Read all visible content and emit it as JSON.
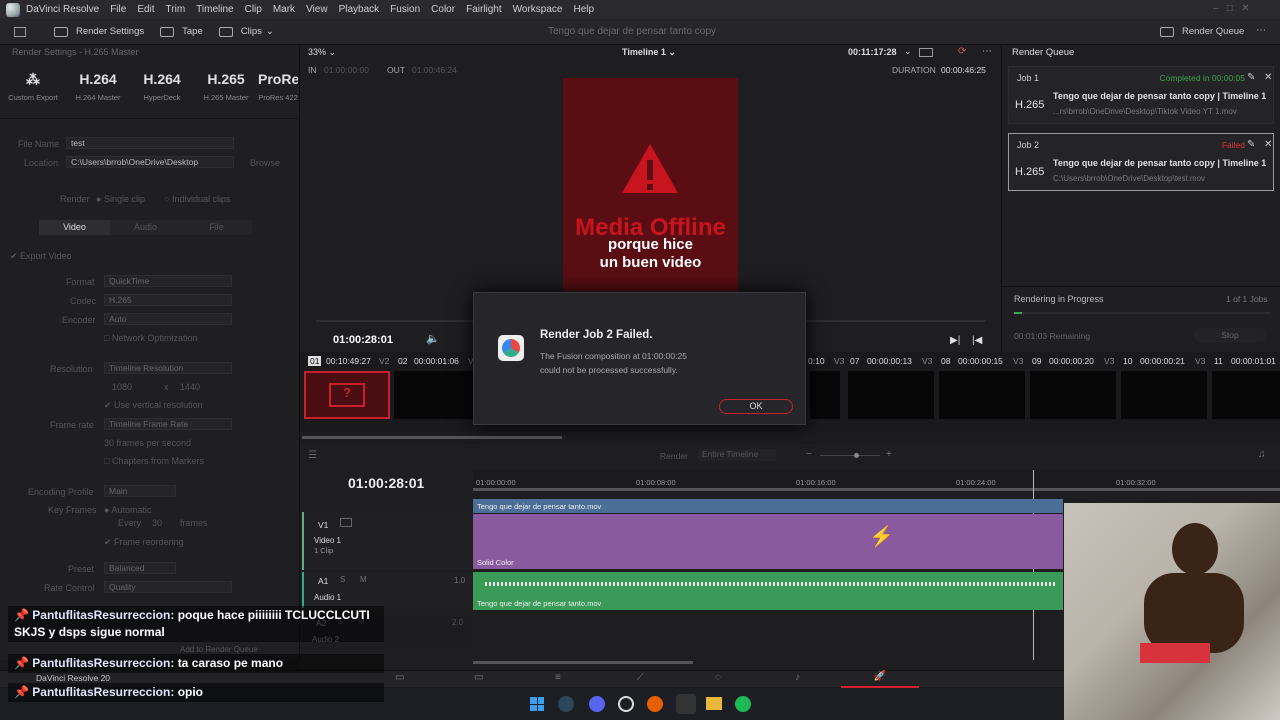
{
  "menubar": {
    "app": "DaVinci Resolve",
    "items": [
      "File",
      "Edit",
      "Trim",
      "Timeline",
      "Clip",
      "Mark",
      "View",
      "Playback",
      "Fusion",
      "Color",
      "Fairlight",
      "Workspace",
      "Help"
    ]
  },
  "topbar": {
    "render_settings": "Render Settings",
    "tape": "Tape",
    "clips": "Clips",
    "project": "Tengo que dejar de pensar tanto copy",
    "render_queue": "Render Queue"
  },
  "left": {
    "title": "Render Settings - H.265 Master",
    "presets": [
      {
        "big": "",
        "small": "Custom Export"
      },
      {
        "big": "H.264",
        "small": "H.264 Master"
      },
      {
        "big": "H.264",
        "small": "HyperDeck"
      },
      {
        "big": "H.265",
        "small": "H.265 Master"
      },
      {
        "big": "ProRe",
        "small": "ProRes 422"
      }
    ],
    "file_name_label": "File Name",
    "file_name": "test",
    "location_label": "Location",
    "location": "C:\\Users\\brrob\\OneDrive\\Desktop",
    "browse": "Browse",
    "render_label": "Render",
    "single_clip": "Single clip",
    "individual_clips": "Individual clips",
    "tabs": [
      "Video",
      "Audio",
      "File"
    ],
    "export_video": "Export Video",
    "format_label": "Format",
    "format": "QuickTime",
    "codec_label": "Codec",
    "codec": "H.265",
    "encoder_label": "Encoder",
    "encoder": "Auto",
    "network_opt": "Network Optimization",
    "resolution_label": "Resolution",
    "resolution": "Timeline Resolution",
    "res_w": "1080",
    "res_x": "x",
    "res_h": "1440",
    "use_vertical": "Use vertical resolution",
    "framerate_label": "Frame rate",
    "framerate": "Timeline Frame Rate",
    "fps": "30 frames per second",
    "chapters": "Chapters from Markers",
    "enc_profile_label": "Encoding Profile",
    "enc_profile": "Main",
    "key_frames_label": "Key Frames",
    "automatic": "Automatic",
    "every": "Every",
    "every_val": "30",
    "frames": "frames",
    "frame_reorder": "Frame reordering",
    "preset_label": "Preset",
    "preset": "Balanced",
    "rate_label": "Rate Control",
    "rate": "Quality",
    "add_render": "Add to Render Queue"
  },
  "viewer": {
    "zoom": "33%",
    "timeline": "Timeline 1",
    "timecode": "00:11:17:28",
    "in_label": "IN",
    "in_tc": "01:00:00:00",
    "out_label": "OUT",
    "out_tc": "01:00:46:24",
    "duration_label": "DURATION",
    "duration": "00:00:46:25",
    "offline": "Media Offline",
    "sub1": "porque hice",
    "sub2": "un buen video",
    "playhead_tc": "01:00:28:01"
  },
  "queue": {
    "title": "Render Queue",
    "jobs": [
      {
        "label": "Job 1",
        "status": "Completed in 00:00:05",
        "fmt": "H.265",
        "name": "Tengo que dejar de pensar tanto copy | Timeline 1",
        "path": "...rs\\brrob\\OneDrive\\Desktop\\Tiktok Video YT 1.mov"
      },
      {
        "label": "Job 2",
        "status": "Failed",
        "fmt": "H.265",
        "name": "Tengo que dejar de pensar tanto copy | Timeline 1",
        "path": "C:\\Users\\brrob\\OneDrive\\Desktop\\test.mov"
      }
    ],
    "progress_label": "Rendering in Progress",
    "jobs_count": "1 of 1 Jobs",
    "remaining": "00:01:03 Remaining",
    "stop": "Stop"
  },
  "dialog": {
    "title": "Render Job 2 Failed.",
    "line1": "The Fusion composition at 01:00:00:25",
    "line2": "could not be processed successfully.",
    "ok": "OK"
  },
  "clips": [
    {
      "n": "01",
      "tc": "00:10:49:27",
      "v": "V2"
    },
    {
      "n": "02",
      "tc": "00:00:01:06",
      "v": "V"
    },
    {
      "n": "",
      "tc": "0:10",
      "v": "V3"
    },
    {
      "n": "07",
      "tc": "00:00:00:13",
      "v": "V3"
    },
    {
      "n": "08",
      "tc": "00:00:00:15",
      "v": "V3"
    },
    {
      "n": "09",
      "tc": "00:00:00:20",
      "v": "V3"
    },
    {
      "n": "10",
      "tc": "00:00:00:21",
      "v": "V3"
    },
    {
      "n": "11",
      "tc": "00:00:01:01",
      "v": ""
    }
  ],
  "timeline": {
    "render_label": "Render",
    "render_sel": "Entire Timeline",
    "tc": "01:00:28:01",
    "ruler": [
      "01:00:00:00",
      "01:00:08:00",
      "01:00:16:00",
      "01:00:24:00",
      "01:00:32:00"
    ],
    "v1": "V1",
    "video1": "Video 1",
    "one_clip": "1 Clip",
    "clip_name": "Tengo que dejar de pensar tanto.mov",
    "solid": "Solid Color",
    "a1": "A1",
    "audio1": "Audio 1",
    "a1_vol": "1.0",
    "a2": "A2",
    "audio2": "Audio 2",
    "a2_vol": "2.0",
    "audio_clip": "Tengo que dejar de pensar tanto.mov"
  },
  "bottom": {
    "version": "DaVinci Resolve 20"
  },
  "chat": [
    {
      "user": "PantuflitasResurreccion:",
      "msg": "poque hace piiiiiiii TCLUCCLCUTI SKJS y dsps sigue normal"
    },
    {
      "user": "PantuflitasResurreccion:",
      "msg": "ta caraso pe mano"
    },
    {
      "user": "PantuflitasResurreccion:",
      "msg": "opio"
    }
  ],
  "colors": {
    "accent_red": "#d6202e",
    "completed": "#3fa34d",
    "failed": "#d33"
  }
}
